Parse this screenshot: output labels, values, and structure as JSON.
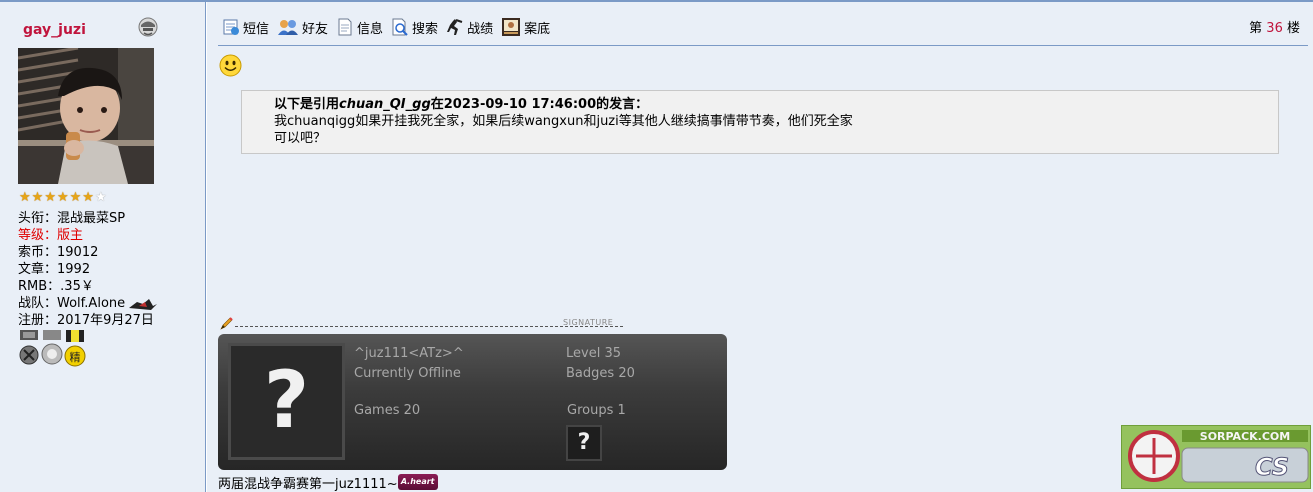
{
  "user": {
    "name": "gay_juzi",
    "stars_filled": 6,
    "stars_total": 7,
    "fields": [
      {
        "label": "头衔：",
        "value": "混战最菜SP",
        "red": false
      },
      {
        "label": "等级：",
        "value": "版主",
        "red": true
      },
      {
        "label": "索币：",
        "value": "19012",
        "red": false
      },
      {
        "label": "文章：",
        "value": "1992",
        "red": false
      },
      {
        "label": "RMB：",
        "value": ".35￥",
        "red": false
      },
      {
        "label": "战队：",
        "value": "Wolf.Alone",
        "red": false
      },
      {
        "label": "注册：",
        "value": "2017年9月27日",
        "red": false
      }
    ]
  },
  "toolbar": {
    "items": [
      {
        "label": "短信",
        "icon": "message-icon"
      },
      {
        "label": "好友",
        "icon": "friends-icon"
      },
      {
        "label": "信息",
        "icon": "info-icon"
      },
      {
        "label": "搜索",
        "icon": "search-icon"
      },
      {
        "label": "战绩",
        "icon": "stats-icon"
      },
      {
        "label": "案底",
        "icon": "record-icon"
      }
    ]
  },
  "floor": {
    "prefix": "第",
    "number": "36",
    "suffix": "楼"
  },
  "quote": {
    "prefix": "以下是引用",
    "author": "chuan_QI_gg",
    "middle": "在2023-09-10 17:46:00的发言：",
    "line1": "我chuanqigg如果开挂我死全家，如果后续wangxun和juzi等其他人继续搞事情带节奏，他们死全家",
    "line2": "可以吧？"
  },
  "signature": {
    "label": "SIGNATURE",
    "steam": {
      "name": "^juz111<ATz>^",
      "status": "Currently Offline",
      "level_label": "Level",
      "level": "35",
      "badges_label": "Badges",
      "badges": "20",
      "games_label": "Games",
      "games": "20",
      "groups_label": "Groups",
      "groups": "1",
      "avatar_glyph": "?",
      "group_glyph": "?"
    },
    "text": "两届混战争霸赛第一juz1111~",
    "badge_text": "A.heart"
  },
  "watermark": {
    "site": "SORPACK.COM",
    "brand": "CS"
  }
}
